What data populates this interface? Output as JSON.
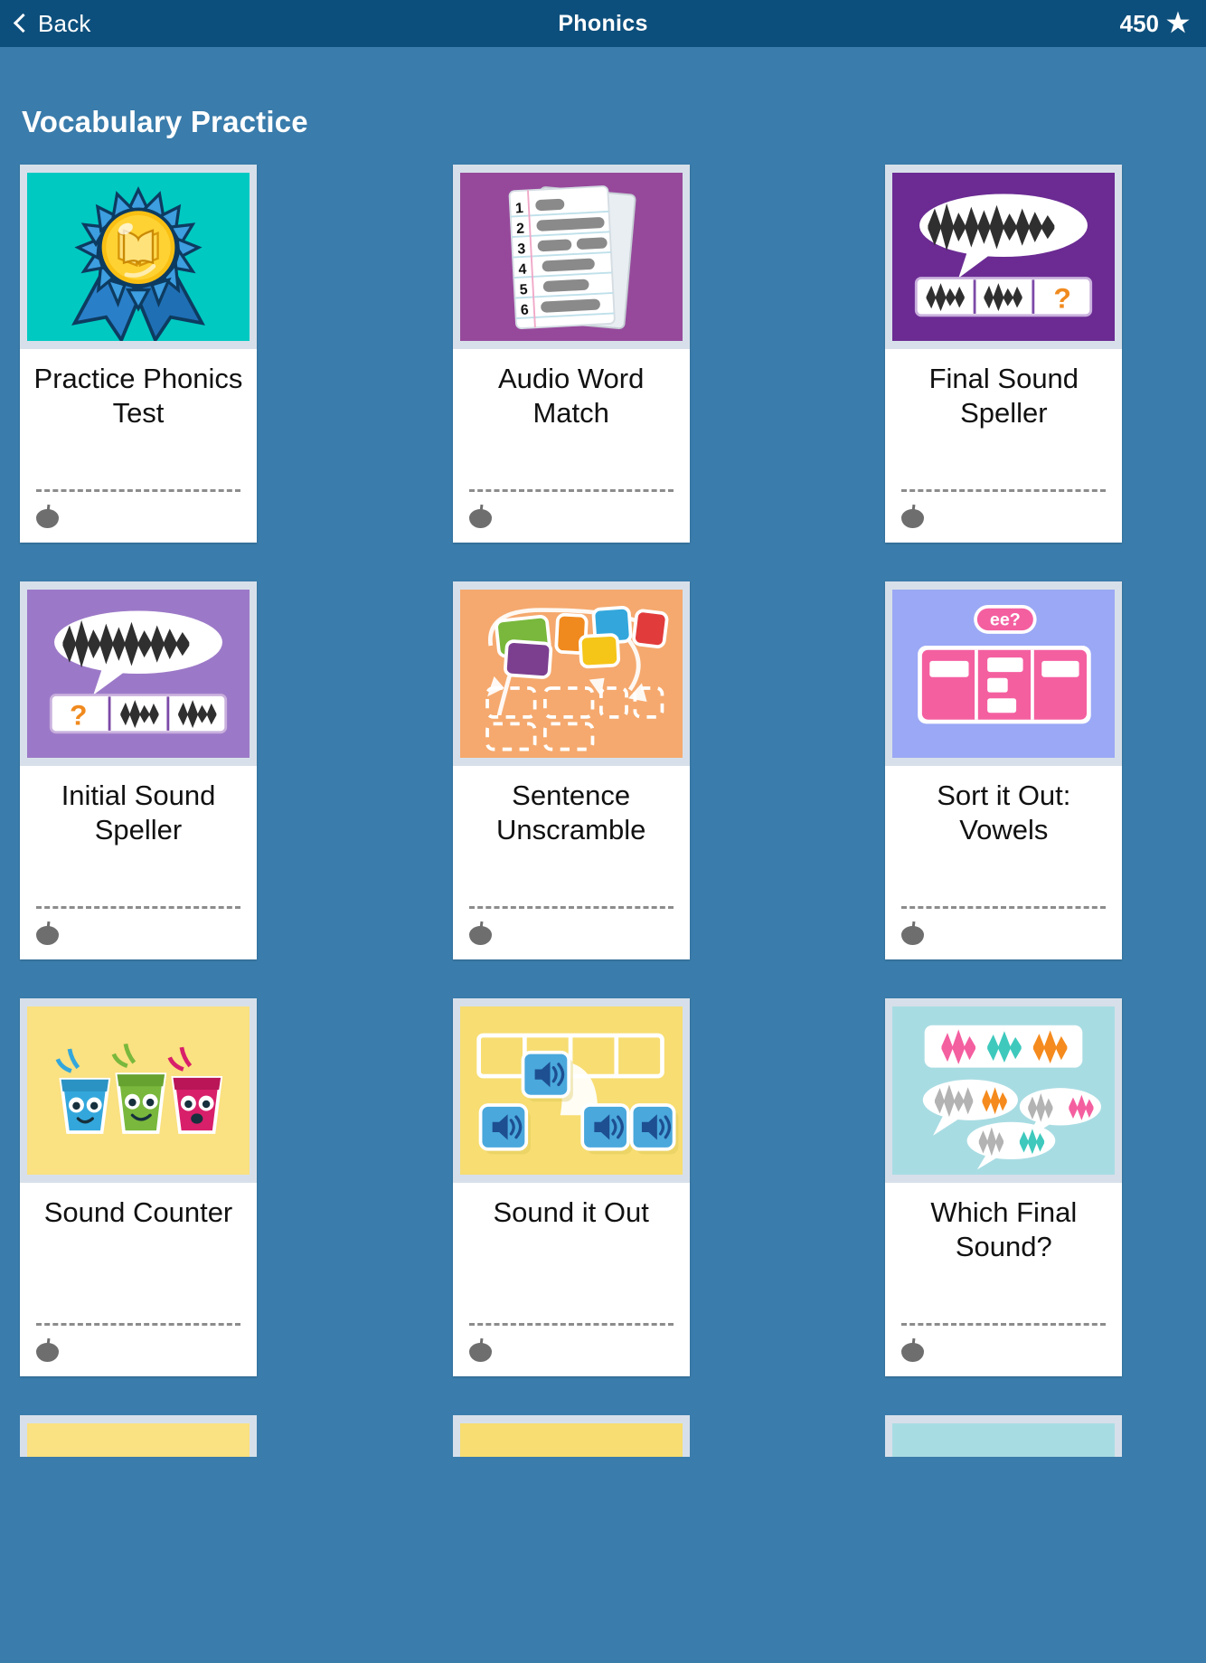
{
  "header": {
    "back_label": "Back",
    "title": "Phonics",
    "score": "450",
    "star_icon": "star-icon",
    "bar_color": "#0d4f7c"
  },
  "page": {
    "background_color": "#3a7cab",
    "section_title": "Vocabulary Practice"
  },
  "activities": [
    {
      "label": "Practice Phonics Test",
      "thumb_color": "#00c9c2",
      "thumb_icon": "award-ribbon-book-icon",
      "progress_icon": "apple-icon"
    },
    {
      "label": "Audio Word Match",
      "thumb_color": "#96499b",
      "thumb_icon": "numbered-worksheet-icon",
      "progress_icon": "apple-icon",
      "list_numbers": [
        "1",
        "2",
        "3",
        "4",
        "5",
        "6"
      ]
    },
    {
      "label": "Final Sound Speller",
      "thumb_color": "#6b2b93",
      "thumb_icon": "speech-bubble-waveform-icon",
      "progress_icon": "apple-icon",
      "question_mark": "?"
    },
    {
      "label": "Initial Sound Speller",
      "thumb_color": "#9c79c8",
      "thumb_icon": "speech-bubble-waveform-icon",
      "progress_icon": "apple-icon",
      "question_mark": "?"
    },
    {
      "label": "Sentence Unscramble",
      "thumb_color": "#f5a96e",
      "thumb_icon": "word-tiles-arrows-icon",
      "progress_icon": "apple-icon"
    },
    {
      "label": "Sort it Out: Vowels",
      "thumb_color": "#9aa8f5",
      "thumb_icon": "sorting-table-icon",
      "progress_icon": "apple-icon",
      "badge_text": "ee?"
    },
    {
      "label": "Sound Counter",
      "thumb_color": "#fae181",
      "thumb_icon": "three-characters-icon",
      "progress_icon": "apple-icon"
    },
    {
      "label": "Sound it Out",
      "thumb_color": "#f7dd72",
      "thumb_icon": "speaker-tiles-icon",
      "progress_icon": "apple-icon"
    },
    {
      "label": "Which Final Sound?",
      "thumb_color": "#a8dce3",
      "thumb_icon": "waveform-bubbles-icon",
      "progress_icon": "apple-icon"
    }
  ]
}
